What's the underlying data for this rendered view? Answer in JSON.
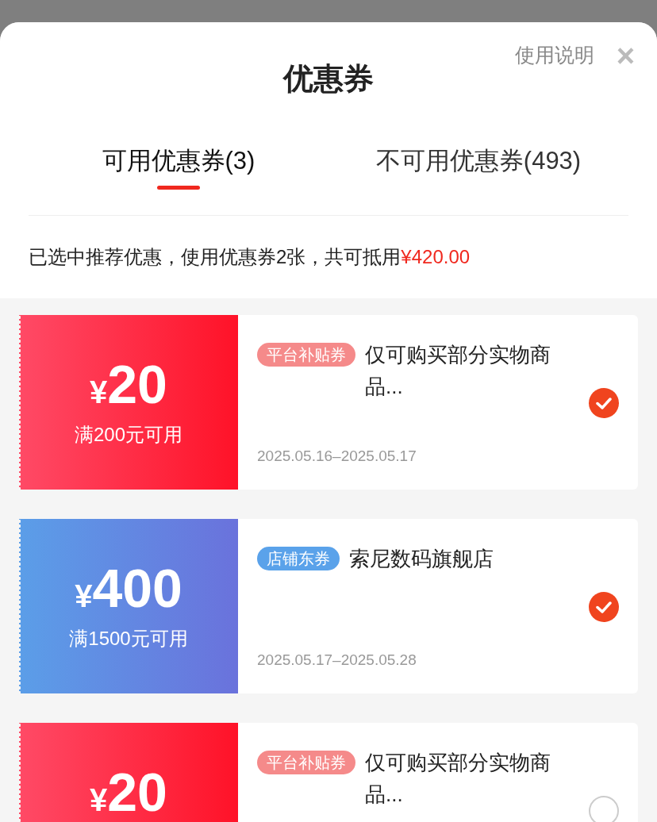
{
  "sheet": {
    "title": "优惠券",
    "help_link": "使用说明",
    "close": "×"
  },
  "tabs": [
    {
      "label": "可用优惠券(3)",
      "selected": true
    },
    {
      "label": "不可用优惠券(493)",
      "selected": false
    }
  ],
  "summary": {
    "text": "已选中推荐优惠，使用优惠券2张，共可抵用",
    "amount": "¥420.00"
  },
  "coupons": [
    {
      "kind": "platform",
      "currency": "¥",
      "amount": "20",
      "condition": "满200元可用",
      "tag": "平台补贴券",
      "title": "仅可购买部分实物商品...",
      "validity": "2025.05.16–2025.05.17",
      "selected": true
    },
    {
      "kind": "store",
      "currency": "¥",
      "amount": "400",
      "condition": "满1500元可用",
      "tag": "店铺东券",
      "title": "索尼数码旗舰店",
      "validity": "2025.05.17–2025.05.28",
      "selected": true
    },
    {
      "kind": "platform",
      "currency": "¥",
      "amount": "20",
      "tag": "平台补贴券",
      "title": "仅可购买部分实物商品...",
      "selected": false
    }
  ]
}
